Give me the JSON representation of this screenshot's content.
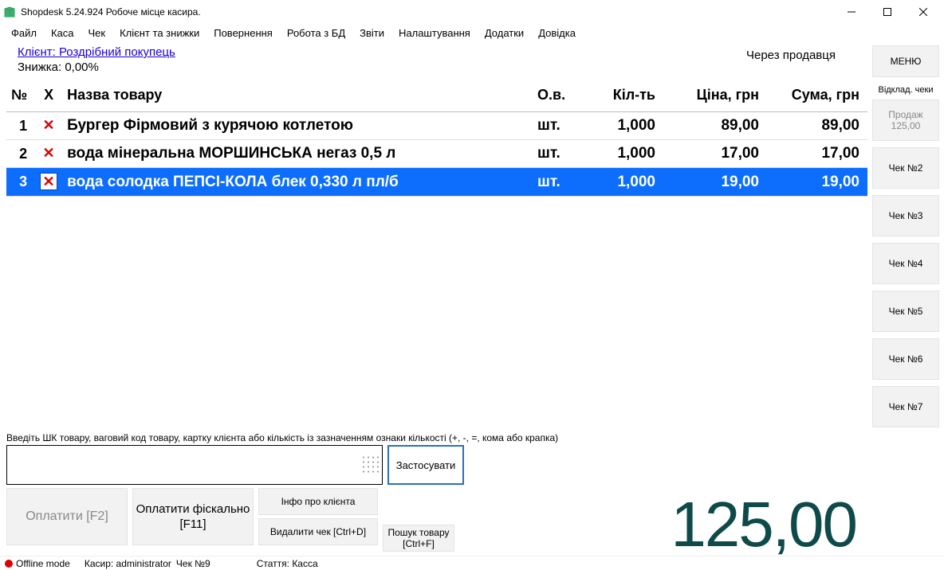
{
  "window": {
    "title": "Shopdesk 5.24.924 Робоче місце касира."
  },
  "menubar": [
    "Файл",
    "Каса",
    "Чек",
    "Клієнт та знижки",
    "Повернення",
    "Робота з БД",
    "Звіти",
    "Налаштування",
    "Додатки",
    "Довідка"
  ],
  "header": {
    "client_label": "Клієнт: Роздрібний покупець",
    "discount_label": "Знижка: 0,00%",
    "seller_label": "Через продавця",
    "menu_btn": "МЕНЮ"
  },
  "table": {
    "columns": {
      "num": "№",
      "del": "Х",
      "name": "Назва товару",
      "unit": "О.в.",
      "qty": "Кіл-ть",
      "price": "Ціна, грн",
      "sum": "Сума, грн"
    },
    "rows": [
      {
        "num": "1",
        "name": "Бургер Фірмовий з курячою котлетою",
        "unit": "шт.",
        "qty": "1,000",
        "price": "89,00",
        "sum": "89,00",
        "selected": false
      },
      {
        "num": "2",
        "name": "вода мінеральна МОРШИНСЬКА негаз 0,5 л",
        "unit": "шт.",
        "qty": "1,000",
        "price": "17,00",
        "sum": "17,00",
        "selected": false
      },
      {
        "num": "3",
        "name": "вода солодка ПЕПСІ-КОЛА блек 0,330 л пл/б",
        "unit": "шт.",
        "qty": "1,000",
        "price": "19,00",
        "sum": "19,00",
        "selected": true
      }
    ]
  },
  "entry": {
    "hint": "Введіть ШК товару, ваговий код товару,  картку клієнта або кількість із зазначенням ознаки кількості (+, -, =, кома або крапка)",
    "apply_btn": "Застосувати"
  },
  "buttons": {
    "pay": "Оплатити [F2]",
    "pay_fiscal": "Оплатити фіскально [F11]",
    "client_info": "Інфо про клієнта",
    "delete_cheque": "Видалити чек [Ctrl+D]",
    "search_item": "Пошук товару [Ctrl+F]"
  },
  "total": "125,00",
  "sidebar": {
    "pending_label": "Відклад. чеки",
    "cheques": [
      {
        "line1": "Продаж",
        "line2": "125,00",
        "active": true
      },
      {
        "line1": "Чек №2"
      },
      {
        "line1": "Чек №3"
      },
      {
        "line1": "Чек №4"
      },
      {
        "line1": "Чек №5"
      },
      {
        "line1": "Чек №6"
      },
      {
        "line1": "Чек №7"
      }
    ]
  },
  "statusbar": {
    "offline": "Offline mode",
    "cashier": "Касир: administrator",
    "cheque": "Чек №9",
    "article": "Стаття: Касса"
  }
}
